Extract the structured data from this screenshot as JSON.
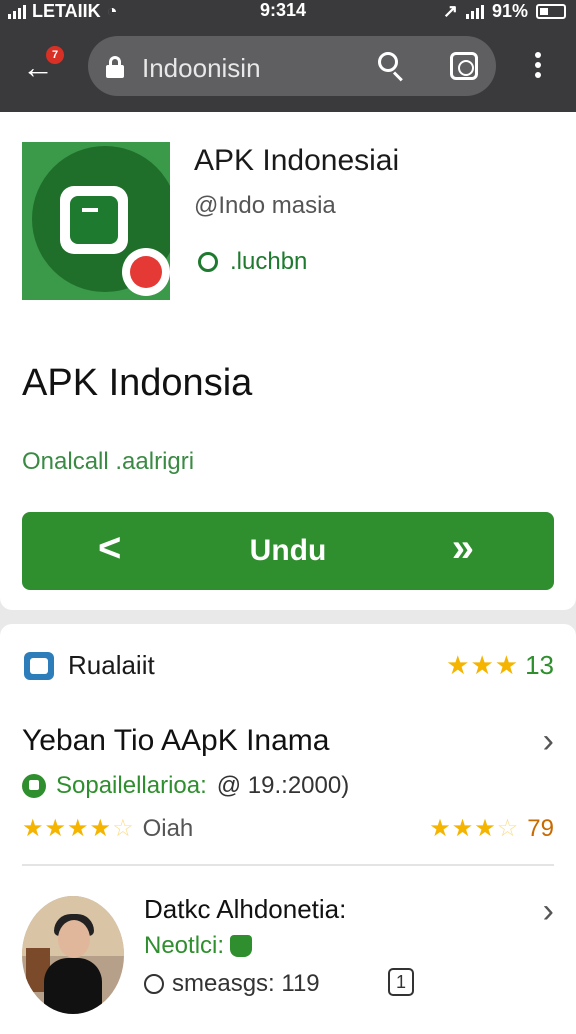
{
  "status_bar": {
    "carrier": "LETAIIK",
    "time": "9:314",
    "battery": "91%"
  },
  "browser": {
    "back_badge": "7",
    "url": "Indoonisin"
  },
  "app": {
    "title": "APK Indonesiai",
    "developer": "@Indo masia",
    "status": ".luchbn",
    "heading": "APK Indonsia",
    "subheading": "Onalcall .aalrigri",
    "download_label": "Undu",
    "download_prev": "<",
    "download_next": "»"
  },
  "section": {
    "title": "Rualaiit",
    "rating_stars": "★★★",
    "rating_value": "13"
  },
  "review": {
    "title": "Yeban Tio AApK Inama",
    "meta_label": "Sopailellarioa:",
    "meta_value": "@ 19.:2000)",
    "stars_left": "★★★★",
    "stars_left_off": "☆",
    "stars_left_text": "Oiah",
    "stars_right": "★★★",
    "stars_right_off": "☆",
    "stars_right_value": "79"
  },
  "user": {
    "title": "Datkc Alhdonetia:",
    "subtitle": "Neotlci:",
    "meta": "smeasgs: 119",
    "badge": "1"
  },
  "chevron": "›"
}
